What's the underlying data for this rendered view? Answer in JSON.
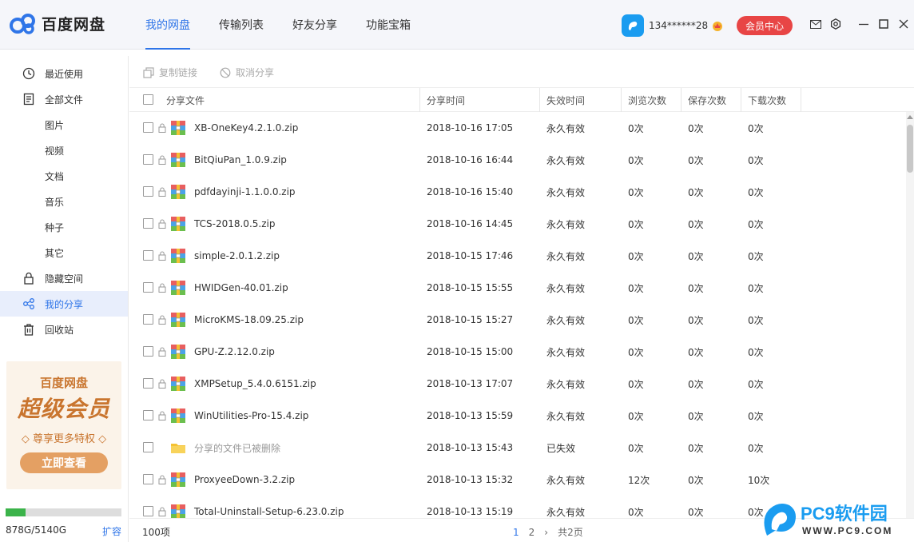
{
  "app": {
    "name": "百度网盘",
    "colors": {
      "accent": "#2f75e8",
      "member": "#e84545",
      "promo": "#c9752f",
      "storage_fill": "#3bb34a"
    }
  },
  "nav": {
    "tabs": [
      {
        "label": "我的网盘",
        "active": true
      },
      {
        "label": "传输列表",
        "active": false
      },
      {
        "label": "好友分享",
        "active": false
      },
      {
        "label": "功能宝箱",
        "active": false
      }
    ]
  },
  "user": {
    "name": "134******28",
    "member_button": "会员中心",
    "icons": [
      "mail-icon",
      "settings-icon",
      "minimize-icon",
      "maximize-icon",
      "close-icon"
    ]
  },
  "sidebar": {
    "items": [
      {
        "label": "最近使用",
        "icon": "clock-icon"
      },
      {
        "label": "全部文件",
        "icon": "file-icon"
      },
      {
        "label": "图片",
        "icon": ""
      },
      {
        "label": "视频",
        "icon": ""
      },
      {
        "label": "文档",
        "icon": ""
      },
      {
        "label": "音乐",
        "icon": ""
      },
      {
        "label": "种子",
        "icon": ""
      },
      {
        "label": "其它",
        "icon": ""
      },
      {
        "label": "隐藏空间",
        "icon": "lock-icon"
      },
      {
        "label": "我的分享",
        "icon": "share-icon",
        "active": true
      },
      {
        "label": "回收站",
        "icon": "trash-icon"
      }
    ],
    "promo": {
      "title": "百度网盘",
      "big": "超级会员",
      "sub": "◇ 尊享更多特权 ◇",
      "button": "立即查看"
    },
    "storage": {
      "text": "878G/5140G",
      "used_fraction": 0.17,
      "expand": "扩容"
    }
  },
  "toolbar": {
    "copy_link": "复制链接",
    "cancel_share": "取消分享"
  },
  "table": {
    "headers": {
      "name": "分享文件",
      "share_time": "分享时间",
      "expire": "失效时间",
      "views": "浏览次数",
      "saves": "保存次数",
      "downloads": "下载次数"
    },
    "rows": [
      {
        "name": "XB-OneKey4.2.1.0.zip",
        "time": "2018-10-16 17:05",
        "expire": "永久有效",
        "views": "0次",
        "saves": "0次",
        "downloads": "0次",
        "type": "zip"
      },
      {
        "name": "BitQiuPan_1.0.9.zip",
        "time": "2018-10-16 16:44",
        "expire": "永久有效",
        "views": "0次",
        "saves": "0次",
        "downloads": "0次",
        "type": "zip"
      },
      {
        "name": "pdfdayinji-1.1.0.0.zip",
        "time": "2018-10-16 15:40",
        "expire": "永久有效",
        "views": "0次",
        "saves": "0次",
        "downloads": "0次",
        "type": "zip"
      },
      {
        "name": "TCS-2018.0.5.zip",
        "time": "2018-10-16 14:45",
        "expire": "永久有效",
        "views": "0次",
        "saves": "0次",
        "downloads": "0次",
        "type": "zip"
      },
      {
        "name": "simple-2.0.1.2.zip",
        "time": "2018-10-15 17:46",
        "expire": "永久有效",
        "views": "0次",
        "saves": "0次",
        "downloads": "0次",
        "type": "zip"
      },
      {
        "name": "HWIDGen-40.01.zip",
        "time": "2018-10-15 15:55",
        "expire": "永久有效",
        "views": "0次",
        "saves": "0次",
        "downloads": "0次",
        "type": "zip"
      },
      {
        "name": "MicroKMS-18.09.25.zip",
        "time": "2018-10-15 15:27",
        "expire": "永久有效",
        "views": "0次",
        "saves": "0次",
        "downloads": "0次",
        "type": "zip"
      },
      {
        "name": "GPU-Z.2.12.0.zip",
        "time": "2018-10-15 15:00",
        "expire": "永久有效",
        "views": "0次",
        "saves": "0次",
        "downloads": "0次",
        "type": "zip"
      },
      {
        "name": "XMPSetup_5.4.0.6151.zip",
        "time": "2018-10-13 17:07",
        "expire": "永久有效",
        "views": "0次",
        "saves": "0次",
        "downloads": "0次",
        "type": "zip"
      },
      {
        "name": "WinUtilities-Pro-15.4.zip",
        "time": "2018-10-13 15:59",
        "expire": "永久有效",
        "views": "0次",
        "saves": "0次",
        "downloads": "0次",
        "type": "zip"
      },
      {
        "name": "分享的文件已被删除",
        "time": "2018-10-13 15:43",
        "expire": "已失效",
        "views": "0次",
        "saves": "0次",
        "downloads": "0次",
        "type": "folder"
      },
      {
        "name": "ProxyeeDown-3.2.zip",
        "time": "2018-10-13 15:32",
        "expire": "永久有效",
        "views": "12次",
        "saves": "0次",
        "downloads": "10次",
        "type": "zip"
      },
      {
        "name": "Total-Uninstall-Setup-6.23.0.zip",
        "time": "2018-10-13 15:19",
        "expire": "永久有效",
        "views": "0次",
        "saves": "0次",
        "downloads": "0次",
        "type": "zip"
      }
    ]
  },
  "footer": {
    "total": "100项",
    "pages": [
      "1",
      "2"
    ],
    "next": "›",
    "total_pages": "共2页"
  },
  "watermark": {
    "text": "PC9软件园",
    "url": "WWW.PC9.COM"
  }
}
